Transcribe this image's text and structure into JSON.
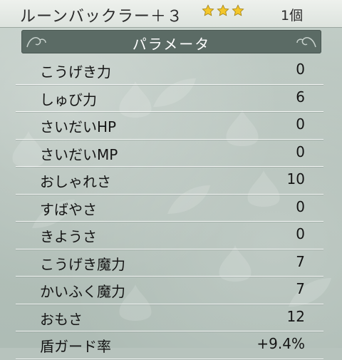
{
  "item": {
    "name": "ルーンバックラー＋３",
    "stars": 3,
    "count": "1個"
  },
  "panel": {
    "title": "パラメータ"
  },
  "stats": [
    {
      "label": "こうげき力",
      "value": "0"
    },
    {
      "label": "しゅび力",
      "value": "6"
    },
    {
      "label": "さいだいHP",
      "value": "0"
    },
    {
      "label": "さいだいMP",
      "value": "0"
    },
    {
      "label": "おしゃれさ",
      "value": "10"
    },
    {
      "label": "すばやさ",
      "value": "0"
    },
    {
      "label": "きようさ",
      "value": "0"
    },
    {
      "label": "こうげき魔力",
      "value": "7"
    },
    {
      "label": "かいふく魔力",
      "value": "7"
    },
    {
      "label": "おもさ",
      "value": "12"
    },
    {
      "label": "盾ガード率",
      "value": "+9.4%"
    }
  ],
  "colors": {
    "star": "#f3c62a",
    "banner": "#5b6b65",
    "background": "#b7c3bd"
  }
}
